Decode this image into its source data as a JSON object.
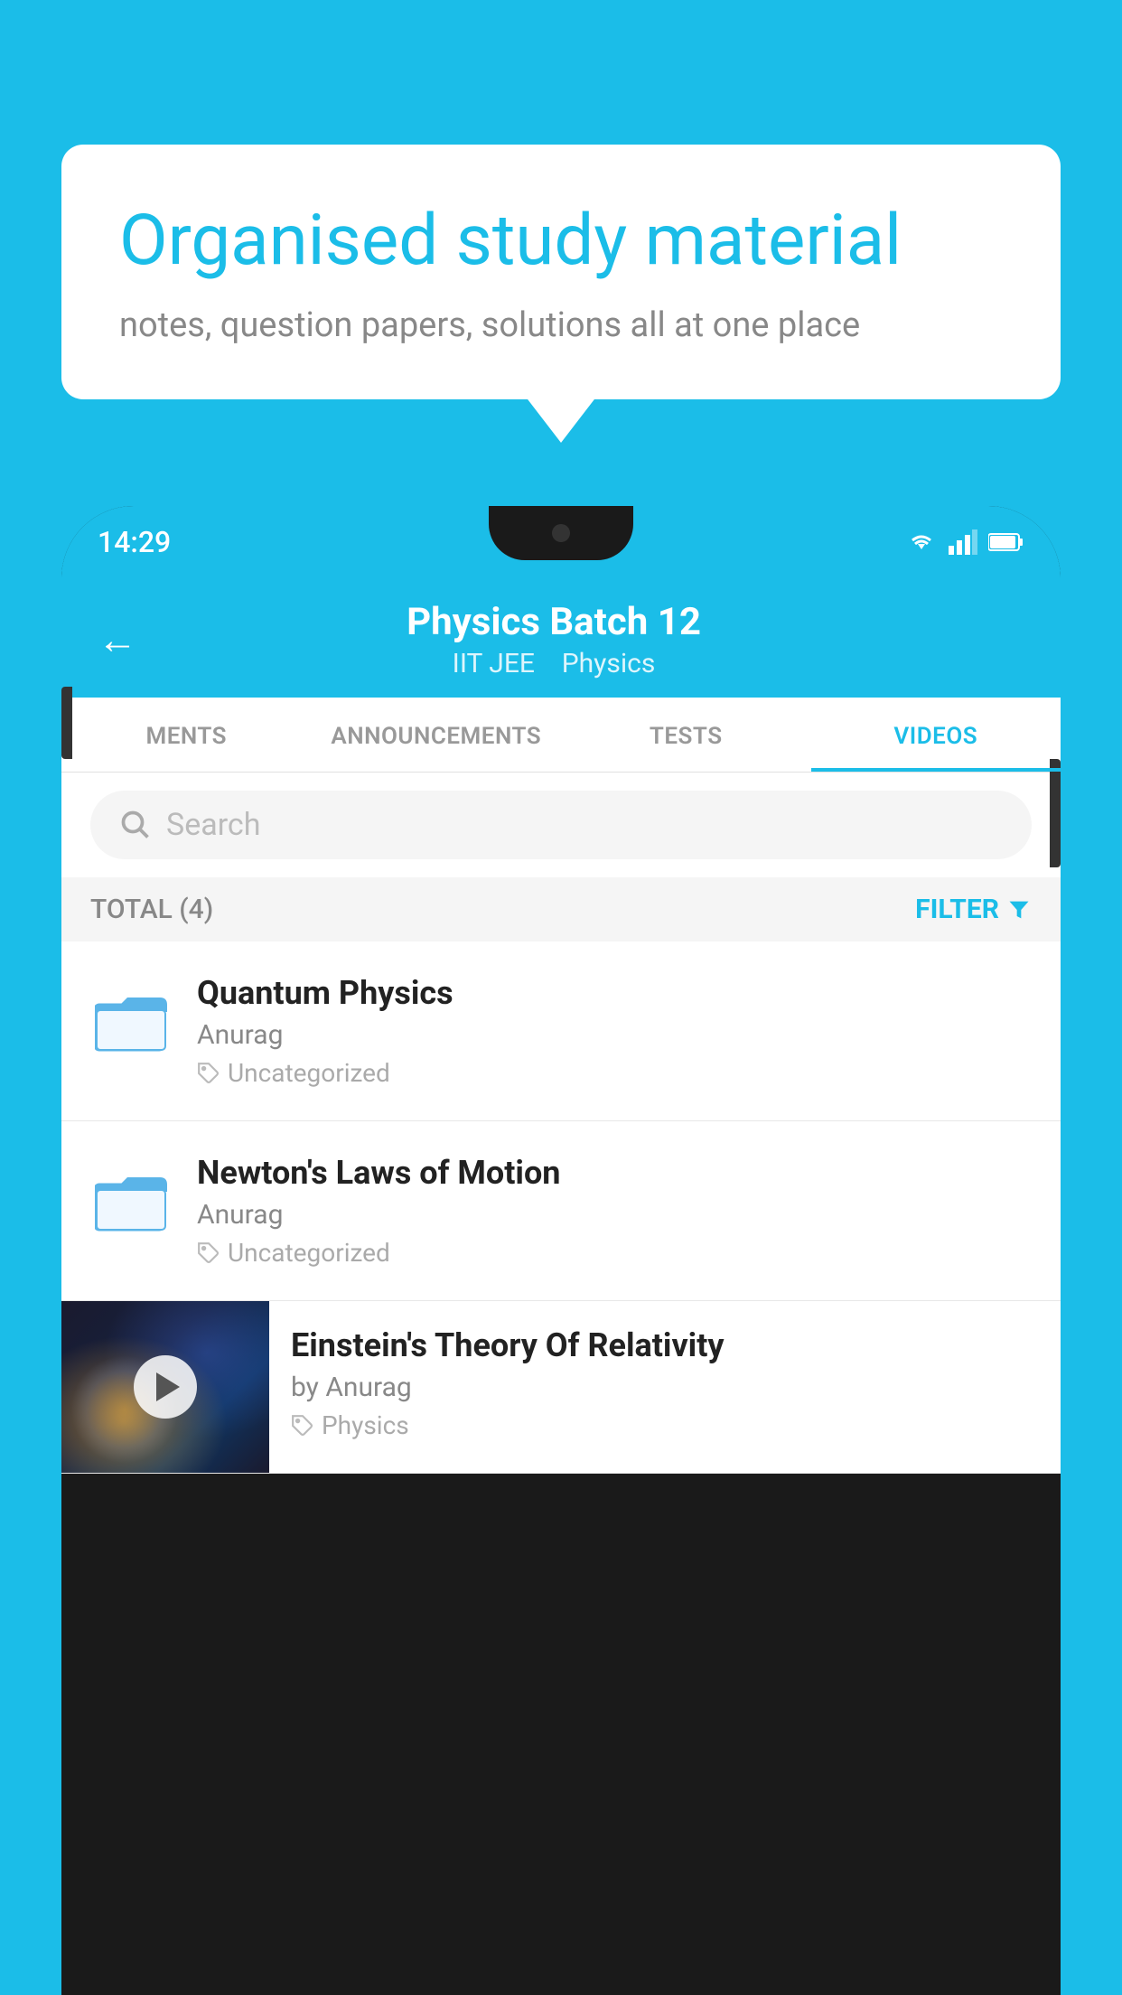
{
  "background_color": "#1BBDE8",
  "speech_bubble": {
    "title": "Organised study material",
    "subtitle": "notes, question papers, solutions all at one place"
  },
  "phone": {
    "status_bar": {
      "time": "14:29"
    },
    "app_header": {
      "back_label": "←",
      "title": "Physics Batch 12",
      "subtitle_tag1": "IIT JEE",
      "subtitle_tag2": "Physics"
    },
    "tabs": [
      {
        "label": "MENTS",
        "active": false
      },
      {
        "label": "ANNOUNCEMENTS",
        "active": false
      },
      {
        "label": "TESTS",
        "active": false
      },
      {
        "label": "VIDEOS",
        "active": true
      }
    ],
    "search": {
      "placeholder": "Search"
    },
    "filter_row": {
      "total_label": "TOTAL (4)",
      "filter_label": "FILTER"
    },
    "video_items": [
      {
        "title": "Quantum Physics",
        "author": "Anurag",
        "tag": "Uncategorized",
        "has_thumbnail": false
      },
      {
        "title": "Newton's Laws of Motion",
        "author": "Anurag",
        "tag": "Uncategorized",
        "has_thumbnail": false
      },
      {
        "title": "Einstein's Theory Of Relativity",
        "author": "by Anurag",
        "tag": "Physics",
        "has_thumbnail": true
      }
    ]
  }
}
